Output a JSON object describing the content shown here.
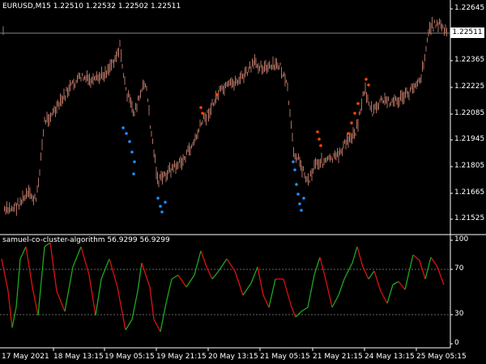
{
  "header": {
    "symbol": "EURUSD,M15",
    "ohlc": "1.22510 1.22532 1.22502 1.22511"
  },
  "price_axis": {
    "ticks": [
      "1.22645",
      "1.22365",
      "1.22225",
      "1.22085",
      "1.21945",
      "1.21805",
      "1.21665",
      "1.21525"
    ],
    "current_price": "1.22511"
  },
  "indicator": {
    "label": "samuel-co-cluster-algorithm 56.9299 56.9299",
    "ticks": [
      "100",
      "70",
      "30",
      "0"
    ]
  },
  "time_axis": {
    "ticks": [
      "17 May 2021",
      "18 May 13:15",
      "19 May 05:15",
      "19 May 21:15",
      "20 May 13:15",
      "21 May 05:15",
      "21 May 21:15",
      "24 May 13:15",
      "25 May 05:15"
    ]
  },
  "colors": {
    "background": "#000000",
    "candles": "#b07060",
    "buy_dots": "#1e90ff",
    "sell_dots": "#ff4500",
    "osc_up": "#1fa81f",
    "osc_down": "#e01010",
    "grid": "#777777"
  }
}
